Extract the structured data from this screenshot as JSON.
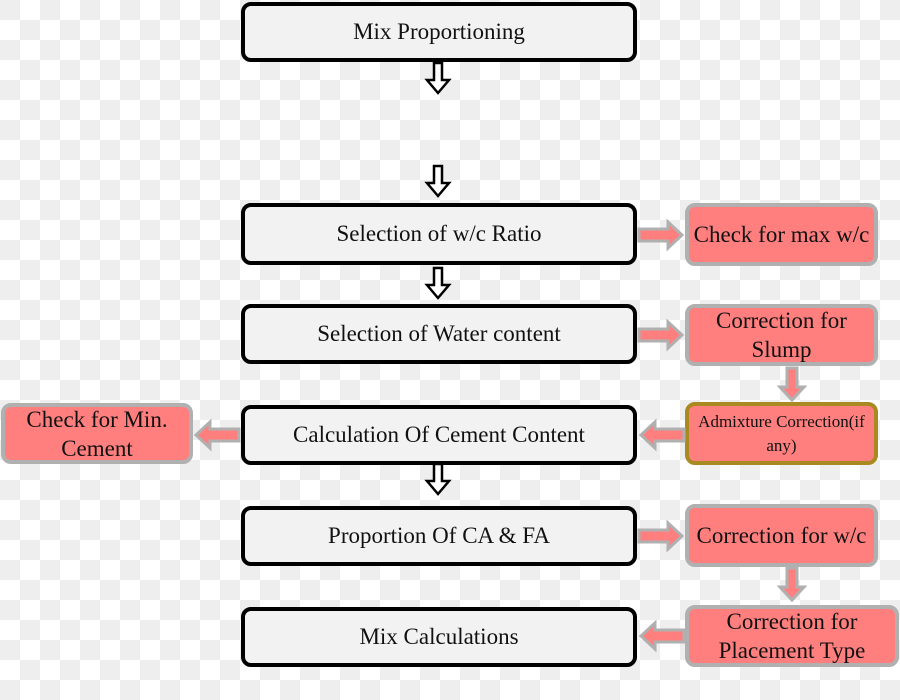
{
  "main_steps": [
    {
      "label": "Mix Proportioning"
    },
    {
      "label": "Selection of w/c Ratio"
    },
    {
      "label": "Selection of Water content"
    },
    {
      "label": "Calculation Of Cement Content"
    },
    {
      "label": "Proportion Of CA & FA"
    },
    {
      "label": "Mix Calculations"
    }
  ],
  "side_checks": [
    {
      "label": "Check for max w/c"
    },
    {
      "label": "Correction for Slump"
    },
    {
      "label": "Admixture Correction(if any)"
    },
    {
      "label": "Correction for w/c"
    },
    {
      "label": "Correction for Placement Type"
    },
    {
      "label": "Check for Min. Cement"
    }
  ],
  "colors": {
    "main_fill": "#f2f2f2",
    "side_fill": "#ff7f7f",
    "side_border": "#b0b0b0",
    "admixture_border": "#a88a20"
  }
}
